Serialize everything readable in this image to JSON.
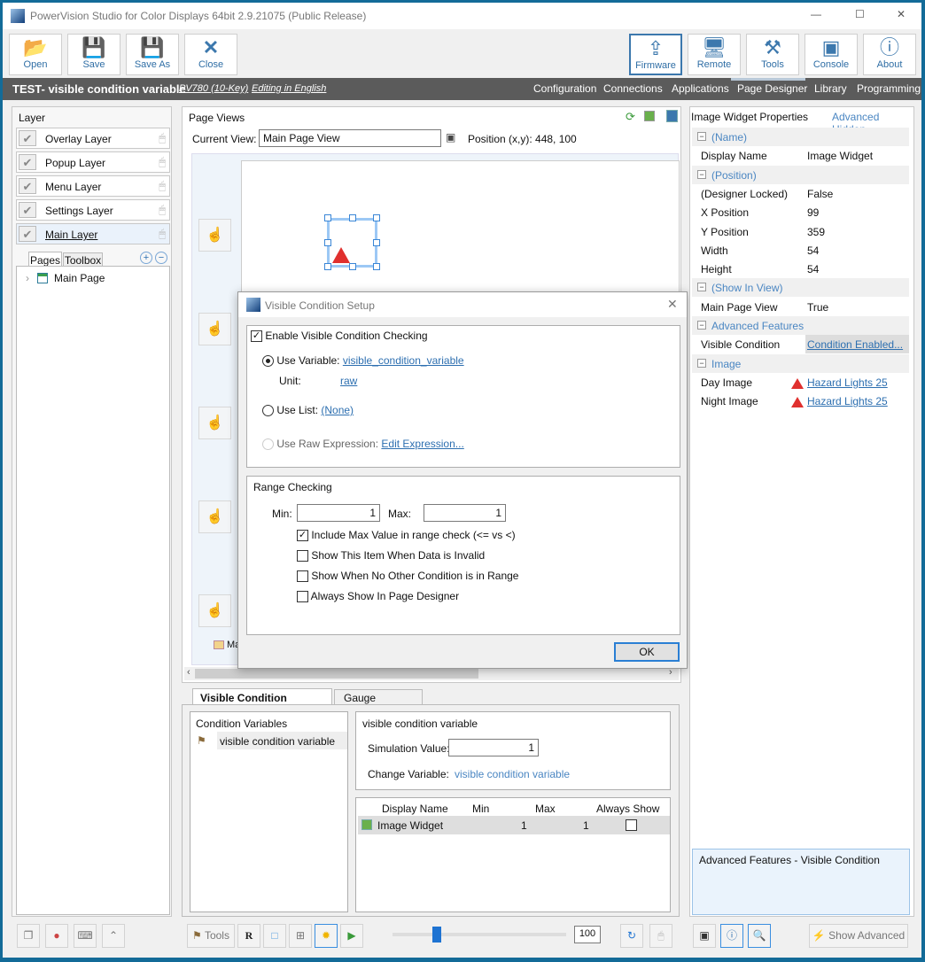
{
  "window": {
    "title": "PowerVision Studio for Color Displays 64bit 2.9.21075 (Public Release)",
    "controls": [
      "—",
      "☐",
      "✕"
    ]
  },
  "toolbar": {
    "left": [
      {
        "label": "Open",
        "icon": "folder-open-icon"
      },
      {
        "label": "Save",
        "icon": "floppy-icon"
      },
      {
        "label": "Save As",
        "icon": "floppy-pen-icon"
      },
      {
        "label": "Close",
        "icon": "close-x-icon"
      }
    ],
    "right": [
      {
        "label": "Firmware",
        "icon": "upload-icon"
      },
      {
        "label": "Remote",
        "icon": "monitor-icon"
      },
      {
        "label": "Tools",
        "icon": "wrench-icon"
      },
      {
        "label": "Console",
        "icon": "console-icon"
      },
      {
        "label": "About",
        "icon": "info-icon"
      }
    ]
  },
  "project": {
    "name": "TEST- visible condition variable",
    "device": "PV780 (10-Key)",
    "language": "Editing in English"
  },
  "nav": {
    "tabs": [
      "Configuration",
      "Connections",
      "Applications",
      "Page Designer",
      "Library",
      "Programming"
    ],
    "active": "Page Designer"
  },
  "layers": {
    "title": "Layer",
    "items": [
      "Overlay Layer",
      "Popup Layer",
      "Menu Layer",
      "Settings Layer",
      "Main Layer"
    ]
  },
  "pages": {
    "tabs": [
      "Pages",
      "Toolbox"
    ],
    "tree": [
      "Main Page"
    ]
  },
  "page_views": {
    "title": "Page Views",
    "current_view_label": "Current View:",
    "current_view": "Main Page View",
    "position": "Position (x,y): 448, 100",
    "page_tab": "Ma"
  },
  "dialog": {
    "title": "Visible Condition Setup",
    "enable_label": "Enable Visible Condition Checking",
    "enabled": true,
    "use_variable_label": "Use Variable:",
    "variable": "visible_condition_variable",
    "unit_label": "Unit:",
    "unit": "raw",
    "use_list_label": "Use List:",
    "list": "(None)",
    "raw_expr_label": "Use Raw Expression:",
    "raw_expr_link": "Edit Expression...",
    "range_title": "Range Checking",
    "min_label": "Min:",
    "min": "1",
    "max_label": "Max:",
    "max": "1",
    "options": [
      {
        "label": "Include Max Value in range check (<= vs <)",
        "checked": true
      },
      {
        "label": "Show This Item When Data is Invalid",
        "checked": false
      },
      {
        "label": "Show When No Other Condition is in Range",
        "checked": false
      },
      {
        "label": "Always Show In Page Designer",
        "checked": false
      }
    ],
    "ok": "OK"
  },
  "bottom": {
    "tabs": [
      "Visible Condition Variables",
      "Gauge Variables"
    ],
    "cond_title": "Condition Variables",
    "cond_items": [
      "visible condition variable"
    ],
    "detail_title": "visible condition variable",
    "sim_label": "Simulation Value:",
    "sim_value": "1",
    "change_label": "Change Variable:",
    "change_link": "visible condition variable",
    "grid_headers": [
      "Display Name",
      "Min",
      "Max",
      "Always Show"
    ],
    "grid_rows": [
      {
        "name": "Image Widget",
        "min": "1",
        "max": "1",
        "always": false
      }
    ],
    "tools_label": "Tools",
    "zoom": "100"
  },
  "properties": {
    "title": "Image Widget Properties",
    "advanced": "Advanced Hidden",
    "rows": [
      {
        "cat": "(Name)"
      },
      {
        "k": "Display Name",
        "v": "Image Widget"
      },
      {
        "cat": "(Position)"
      },
      {
        "k": "(Designer Locked)",
        "v": "False"
      },
      {
        "k": "X Position",
        "v": "99"
      },
      {
        "k": "Y Position",
        "v": "359"
      },
      {
        "k": "Width",
        "v": "54"
      },
      {
        "k": "Height",
        "v": "54"
      },
      {
        "cat": "(Show In View)"
      },
      {
        "k": "Main Page View",
        "v": "True"
      },
      {
        "cat": "Advanced Features"
      },
      {
        "k": "Visible Condition",
        "v": "Condition Enabled...",
        "link": true
      },
      {
        "cat": "Image"
      },
      {
        "k": "Day Image",
        "v": "Hazard Lights 25",
        "link": true,
        "icon": "hazard-icon"
      },
      {
        "k": "Night Image",
        "v": "Hazard Lights 25",
        "link": true,
        "icon": "hazard-icon"
      }
    ],
    "help": "Advanced Features - Visible Condition",
    "show_advanced": "Show Advanced"
  }
}
